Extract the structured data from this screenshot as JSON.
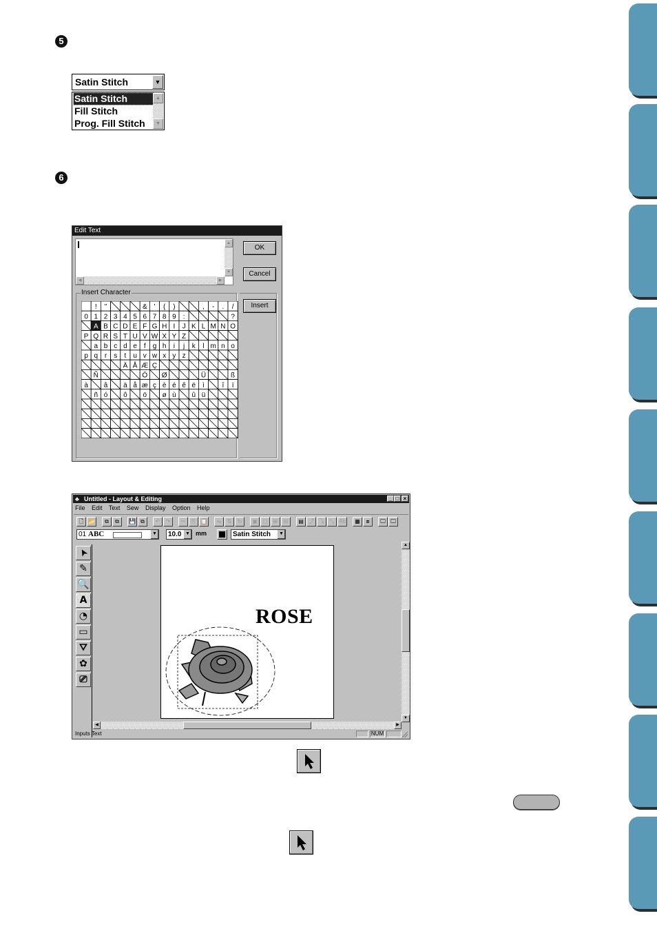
{
  "steps": [
    {
      "number": "5"
    },
    {
      "number": "6"
    }
  ],
  "stitch_combo": {
    "selected_value": "Satin Stitch",
    "options": [
      "Satin Stitch",
      "Fill Stitch",
      "Prog. Fill Stitch"
    ],
    "highlighted_index": 0
  },
  "edit_text_dialog": {
    "title": "Edit Text",
    "text_value": "",
    "ok_label": "OK",
    "cancel_label": "Cancel",
    "insert_group_label": "Insert Character",
    "insert_label": "Insert",
    "selected_char": "A",
    "char_grid": [
      [
        " ",
        "!",
        "\"",
        "\\",
        "\\",
        "\\",
        "&",
        "'",
        "(",
        ")",
        "\\",
        "\\",
        ",",
        "-",
        ".",
        "/"
      ],
      [
        "0",
        "1",
        "2",
        "3",
        "4",
        "5",
        "6",
        "7",
        "8",
        "9",
        ":",
        "\\",
        "\\",
        "\\",
        "\\",
        "?"
      ],
      [
        "\\",
        "A",
        "B",
        "C",
        "D",
        "E",
        "F",
        "G",
        "H",
        "I",
        "J",
        "K",
        "L",
        "M",
        "N",
        "O"
      ],
      [
        "P",
        "Q",
        "R",
        "S",
        "T",
        "U",
        "V",
        "W",
        "X",
        "Y",
        "Z",
        "\\",
        "\\",
        "\\",
        "\\",
        "\\"
      ],
      [
        "\\",
        "a",
        "b",
        "c",
        "d",
        "e",
        "f",
        "g",
        "h",
        "i",
        "j",
        "k",
        "l",
        "m",
        "n",
        "o"
      ],
      [
        "p",
        "q",
        "r",
        "s",
        "t",
        "u",
        "v",
        "w",
        "x",
        "y",
        "z",
        "\\",
        "\\",
        "\\",
        "\\",
        "\\"
      ],
      [
        "\\",
        "\\",
        "\\",
        "\\",
        "Ä",
        "Å",
        "Æ",
        "Ç",
        "\\",
        "\\",
        "\\",
        "\\",
        "\\",
        "\\",
        "\\",
        "\\"
      ],
      [
        "\\",
        "Ñ",
        "\\",
        "\\",
        "\\",
        "\\",
        "Ö",
        "\\",
        "Ø",
        "\\",
        "\\",
        "\\",
        "Ü",
        "\\",
        "\\",
        "ß"
      ],
      [
        "à",
        "\\",
        "â",
        "\\",
        "ä",
        "å",
        "æ",
        "ç",
        "è",
        "é",
        "ê",
        "ë",
        "ì",
        "\\",
        "î",
        "ï"
      ],
      [
        "\\",
        "ñ",
        "ó",
        "\\",
        "ô",
        "\\",
        "ö",
        "\\",
        "ø",
        "ù",
        "\\",
        "û",
        "ü",
        "\\",
        "\\",
        "\\"
      ],
      [
        "\\",
        "\\",
        "\\",
        "\\",
        "\\",
        "\\",
        "\\",
        "\\",
        "\\",
        "\\",
        "\\",
        "\\",
        "\\",
        "\\",
        "\\",
        "\\"
      ],
      [
        "\\",
        "\\",
        "\\",
        "\\",
        "\\",
        "\\",
        "\\",
        "\\",
        "\\",
        "\\",
        "\\",
        "\\",
        "\\",
        "\\",
        "\\",
        "\\"
      ],
      [
        "\\",
        "\\",
        "\\",
        "\\",
        "\\",
        "\\",
        "\\",
        "\\",
        "\\",
        "\\",
        "\\",
        "\\",
        "\\",
        "\\",
        "\\",
        "\\"
      ],
      [
        "\\",
        "\\",
        "\\",
        "\\",
        "\\",
        "\\",
        "\\",
        "\\",
        "\\",
        "\\",
        "\\",
        "\\",
        "\\",
        "\\",
        "\\",
        "\\"
      ]
    ]
  },
  "app_window": {
    "title": "Untitled - Layout & Editing",
    "window_controls": [
      "_",
      "□",
      "×"
    ],
    "menu": [
      "File",
      "Edit",
      "Text",
      "Sew",
      "Display",
      "Option",
      "Help"
    ],
    "toolbar_buttons": [
      {
        "name": "new-icon",
        "glyph": "🗋",
        "enabled": true
      },
      {
        "name": "open-icon",
        "glyph": "📂",
        "enabled": true
      },
      {
        "name": "import-icon",
        "glyph": "⧉",
        "enabled": true
      },
      {
        "name": "import-pattern-icon",
        "glyph": "⧉",
        "enabled": true
      },
      {
        "name": "save-icon",
        "glyph": "💾",
        "enabled": true
      },
      {
        "name": "save-as-icon",
        "glyph": "⧉",
        "enabled": true
      },
      {
        "name": "undo-icon",
        "glyph": "↶",
        "enabled": false
      },
      {
        "name": "redo-icon",
        "glyph": "↷",
        "enabled": false
      },
      {
        "name": "cut-icon",
        "glyph": "✂",
        "enabled": false
      },
      {
        "name": "copy-icon",
        "glyph": "⎘",
        "enabled": false
      },
      {
        "name": "paste-icon",
        "glyph": "📋",
        "enabled": true
      },
      {
        "name": "mirror-icon",
        "glyph": "⇋",
        "enabled": false
      },
      {
        "name": "flip-icon",
        "glyph": "⇅",
        "enabled": false
      },
      {
        "name": "rotate-icon",
        "glyph": "↻",
        "enabled": false
      },
      {
        "name": "group-icon",
        "glyph": "▣",
        "enabled": false
      },
      {
        "name": "ungroup-icon",
        "glyph": "▢",
        "enabled": false
      },
      {
        "name": "align-icon",
        "glyph": "⊞",
        "enabled": false
      },
      {
        "name": "arrange-icon",
        "glyph": "⊟",
        "enabled": false
      },
      {
        "name": "text-attr-icon",
        "glyph": "▤",
        "enabled": true
      },
      {
        "name": "fit-path-icon",
        "glyph": "⤴",
        "enabled": false
      },
      {
        "name": "text-path-icon",
        "glyph": "⤵",
        "enabled": false
      },
      {
        "name": "transform-icon",
        "glyph": "⤡",
        "enabled": false
      },
      {
        "name": "abc-icon",
        "glyph": "Ab",
        "enabled": false
      },
      {
        "name": "sew-attr-icon",
        "glyph": "▦",
        "enabled": true
      },
      {
        "name": "stitch-icon",
        "glyph": "⧈",
        "enabled": true
      },
      {
        "name": "preview-icon",
        "glyph": "🖵",
        "enabled": true
      },
      {
        "name": "realistic-preview-icon",
        "glyph": "🖵",
        "enabled": true
      }
    ],
    "font_select": {
      "number": "01",
      "sample": "ABC",
      "value": ""
    },
    "size_select": {
      "value": "10.0",
      "unit": "mm"
    },
    "stitch_select": {
      "value": "Satin Stitch"
    },
    "tools": [
      {
        "name": "select-arrow-icon",
        "active": false
      },
      {
        "name": "point-edit-icon",
        "active": false
      },
      {
        "name": "zoom-icon",
        "active": false
      },
      {
        "name": "text-tool-icon",
        "active": true
      },
      {
        "name": "shape-tool-icon",
        "active": false
      },
      {
        "name": "rectangle-tool-icon",
        "active": false
      },
      {
        "name": "outline-tool-icon",
        "active": false
      },
      {
        "name": "brush-tool-icon",
        "active": false
      },
      {
        "name": "break-tool-icon",
        "active": false
      }
    ],
    "canvas_text": "ROSE",
    "status_text": "Inputs Text",
    "status_indicators": [
      "",
      "NUM",
      ""
    ]
  },
  "colors": {
    "tab": "#5b9ab7",
    "tab_shadow": "#2e2e2e",
    "win_face": "#c0c0c0",
    "title_bar": "#1a1a1a"
  },
  "side_tabs_count": 9
}
